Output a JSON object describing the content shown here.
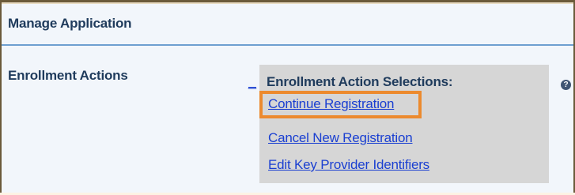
{
  "header": {
    "title": "Manage Application"
  },
  "enrollment": {
    "label": "Enrollment Actions",
    "dash_link": "_",
    "panel_heading": "Enrollment Action Selections:",
    "actions": [
      {
        "label": "Continue Registration",
        "highlighted": true
      },
      {
        "label": "Cancel New Registration",
        "highlighted": false
      },
      {
        "label": "Edit Key Provider Identifiers",
        "highlighted": false
      }
    ],
    "help_icon": "question-circle-icon",
    "help_glyph": "?"
  },
  "colors": {
    "link": "#1a3fd1",
    "highlight": "#ec8a2e",
    "heading": "#1f3b5c",
    "panel": "#d6d6d6",
    "divider": "#6e9fd0"
  }
}
